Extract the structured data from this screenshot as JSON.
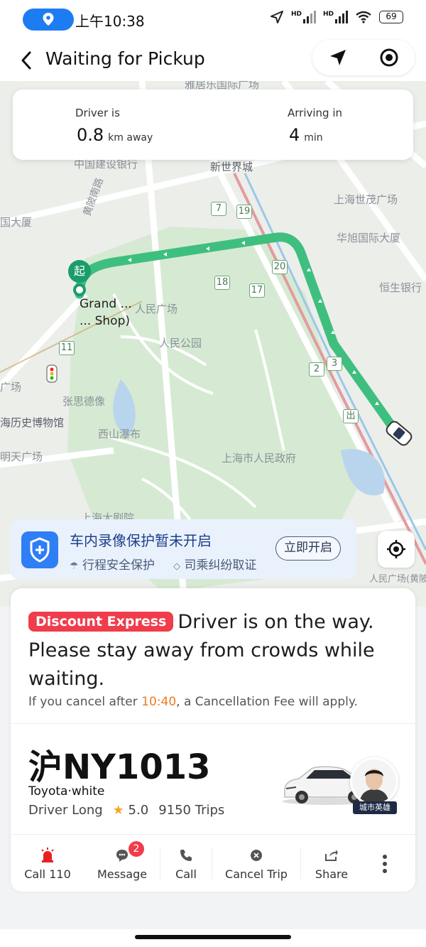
{
  "status_bar": {
    "time": "上午10:38",
    "hd1": "HD",
    "hd2": "HD",
    "battery": "69"
  },
  "header": {
    "title": "Waiting for Pickup",
    "back_icon": "chevron-left-icon",
    "nav_icon": "navigation-arrow-icon",
    "target_icon": "target-icon"
  },
  "eta": {
    "driver_label": "Driver is",
    "distance_value": "0.8",
    "distance_unit": "km away",
    "arriving_label": "Arriving in",
    "time_value": "4",
    "time_unit": "min"
  },
  "map": {
    "labels": [
      "雅居乐国际广场",
      "中国建设银行",
      "新世界城",
      "上海世茂广场",
      "国大厦",
      "黄陂南路",
      "华旭国际大厦",
      "恒生银行",
      "人民广场",
      "人民公园",
      "张思德像",
      "西山瀑布",
      "上海市人民政府",
      "海历史博物馆",
      "明天广场",
      "上海大剧院",
      "人民广场(黄陂路)",
      "广场"
    ],
    "route_numbers": [
      "7",
      "19",
      "20",
      "18",
      "17",
      "11",
      "2",
      "3"
    ],
    "exit_label": "出",
    "start_marker": "起",
    "start_label_line1": "Grand ...",
    "start_label_line2": "... Shop)"
  },
  "safety_banner": {
    "title": "车内录像保护暂未开启",
    "sub1": "行程安全保护",
    "sub2": "司乘纠纷取证",
    "button": "立即开启"
  },
  "trip": {
    "badge": "Discount Express",
    "message": "Driver is on the way. Please stay away from crowds while waiting.",
    "cancel_prefix": "If you cancel after ",
    "cancel_time": "10:40",
    "cancel_suffix": ", a Cancellation Fee will apply.",
    "plate": "沪NY1013",
    "car_model": "Toyota·white",
    "driver_name": "Driver Long",
    "rating": "5.0",
    "trips": "9150 Trips",
    "avatar_tag": "城市英雄"
  },
  "actions": [
    {
      "label": "Call 110",
      "icon": "siren-icon"
    },
    {
      "label": "Message",
      "icon": "chat-bubble-icon",
      "badge": "2"
    },
    {
      "label": "Call",
      "icon": "phone-icon"
    },
    {
      "label": "Cancel Trip",
      "icon": "close-circle-icon"
    },
    {
      "label": "Share",
      "icon": "share-icon"
    }
  ],
  "colors": {
    "route": "#3fbf7f",
    "accent_blue": "#1e7cf2",
    "badge_red": "#f03c4b",
    "highlight_orange": "#f07a22",
    "park_green": "#d6ead3"
  }
}
